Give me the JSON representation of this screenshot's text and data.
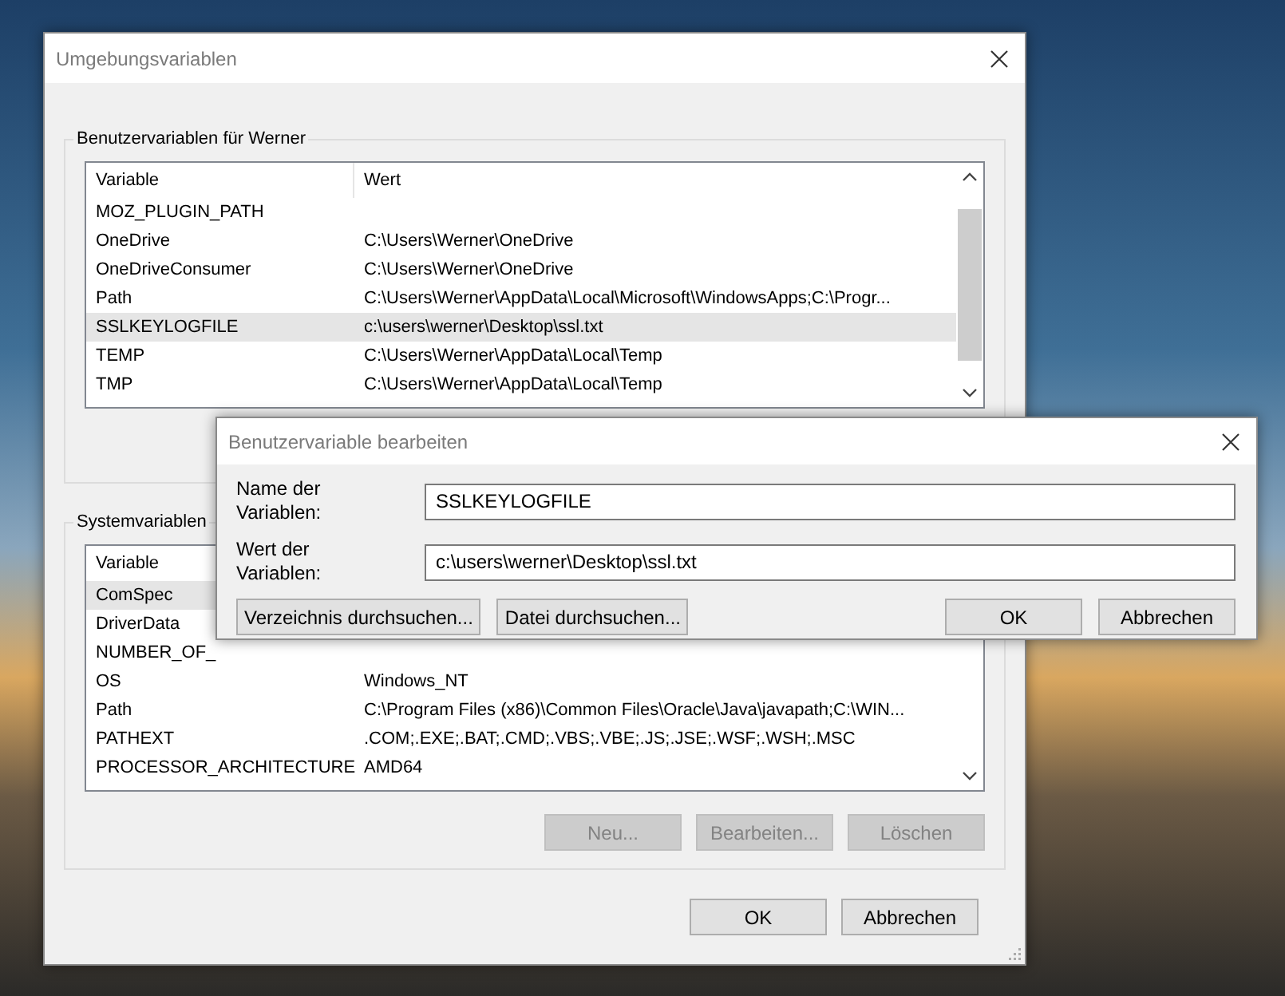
{
  "window": {
    "title": "Umgebungsvariablen"
  },
  "user_variables": {
    "title": "Benutzervariablen für Werner",
    "columns": [
      "Variable",
      "Wert"
    ],
    "rows": [
      {
        "variable": "MOZ_PLUGIN_PATH",
        "selected": false
      },
      {
        "variable": "OneDrive",
        "value": "C:\\Users\\Werner\\OneDrive",
        "selected": false
      },
      {
        "variable": "OneDriveConsumer",
        "value": "C:\\Users\\Werner\\OneDrive",
        "selected": false
      },
      {
        "variable": "Path",
        "value": "C:\\Users\\Werner\\AppData\\Local\\Microsoft\\WindowsApps;C:\\Progr...",
        "selected": false
      },
      {
        "variable": "SSLKEYLOGFILE",
        "value": "c:\\users\\werner\\Desktop\\ssl.txt",
        "selected": true
      },
      {
        "variable": "TEMP",
        "value": "C:\\Users\\Werner\\AppData\\Local\\Temp",
        "selected": false
      },
      {
        "variable": "TMP",
        "value": "C:\\Users\\Werner\\AppData\\Local\\Temp",
        "selected": false
      }
    ]
  },
  "system_variables": {
    "title": "Systemvariablen",
    "columns": [
      "Variable"
    ],
    "rows": [
      {
        "variable": "ComSpec",
        "selected": true
      },
      {
        "variable": "DriverData",
        "selected": false
      },
      {
        "variable": "NUMBER_OF_",
        "selected": false
      },
      {
        "variable": "OS",
        "value": "Windows_NT",
        "selected": false
      },
      {
        "variable": "Path",
        "value": "C:\\Program Files (x86)\\Common Files\\Oracle\\Java\\javapath;C:\\WIN...",
        "selected": false
      },
      {
        "variable": "PATHEXT",
        "value": ".COM;.EXE;.BAT;.CMD;.VBS;.VBE;.JS;.JSE;.WSF;.WSH;.MSC",
        "selected": false
      },
      {
        "variable": "PROCESSOR_ARCHITECTURE",
        "value": "AMD64",
        "selected": false
      }
    ],
    "buttons": [
      {
        "label": "Neu...",
        "disabled": true
      },
      {
        "label": "Bearbeiten...",
        "disabled": true
      },
      {
        "label": "Löschen",
        "disabled": true
      }
    ]
  },
  "buttons": [
    "OK",
    "Abbrechen"
  ],
  "edit_dialog": {
    "title": "Benutzervariable bearbeiten",
    "fields": [
      {
        "label": "Name der Variablen:",
        "value": "SSLKEYLOGFILE"
      },
      {
        "label": "Wert der Variablen:",
        "value": "c:\\users\\werner\\Desktop\\ssl.txt"
      }
    ],
    "browse_buttons": [
      "Verzeichnis durchsuchen...",
      "Datei durchsuchen..."
    ],
    "buttons": [
      "OK",
      "Abbrechen"
    ]
  }
}
